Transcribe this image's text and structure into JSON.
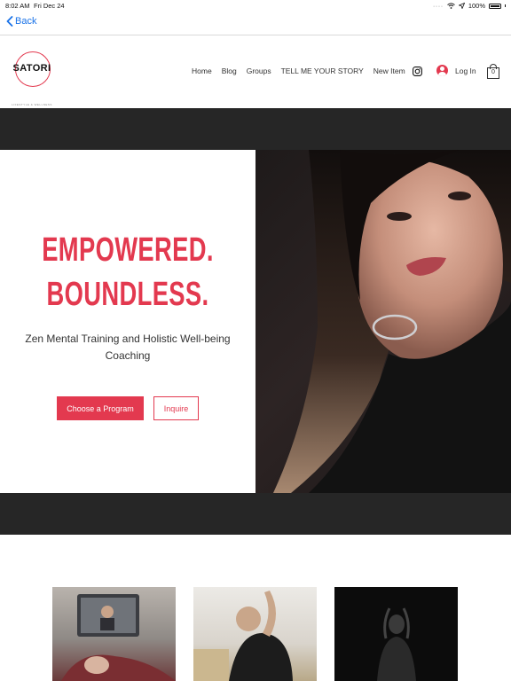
{
  "status_bar": {
    "time": "8:02 AM",
    "date": "Fri Dec 24",
    "battery": "100%"
  },
  "browser": {
    "back_label": "Back"
  },
  "header": {
    "logo_text": "SATORI",
    "logo_tagline": "LIFESTYLE & WELLNESS",
    "nav_items": [
      "Home",
      "Blog",
      "Groups",
      "TELL ME YOUR STORY",
      "New Item"
    ],
    "login_label": "Log In",
    "cart_count": "0"
  },
  "hero": {
    "headline_line1": "EMPOWERED.",
    "headline_line2": "BOUNDLESS.",
    "subline": "Zen Mental Training and Holistic Well-being Coaching",
    "primary_button": "Choose a Program",
    "secondary_button": "Inquire"
  },
  "colors": {
    "accent": "#e3394f",
    "dark_band": "#262626",
    "link_blue": "#1a73e8"
  },
  "icons": {
    "back": "chevron-left-icon",
    "instagram": "instagram-icon",
    "user": "user-avatar-icon",
    "cart": "shopping-bag-icon",
    "wifi": "wifi-icon",
    "location": "location-arrow-icon",
    "battery": "battery-icon"
  }
}
